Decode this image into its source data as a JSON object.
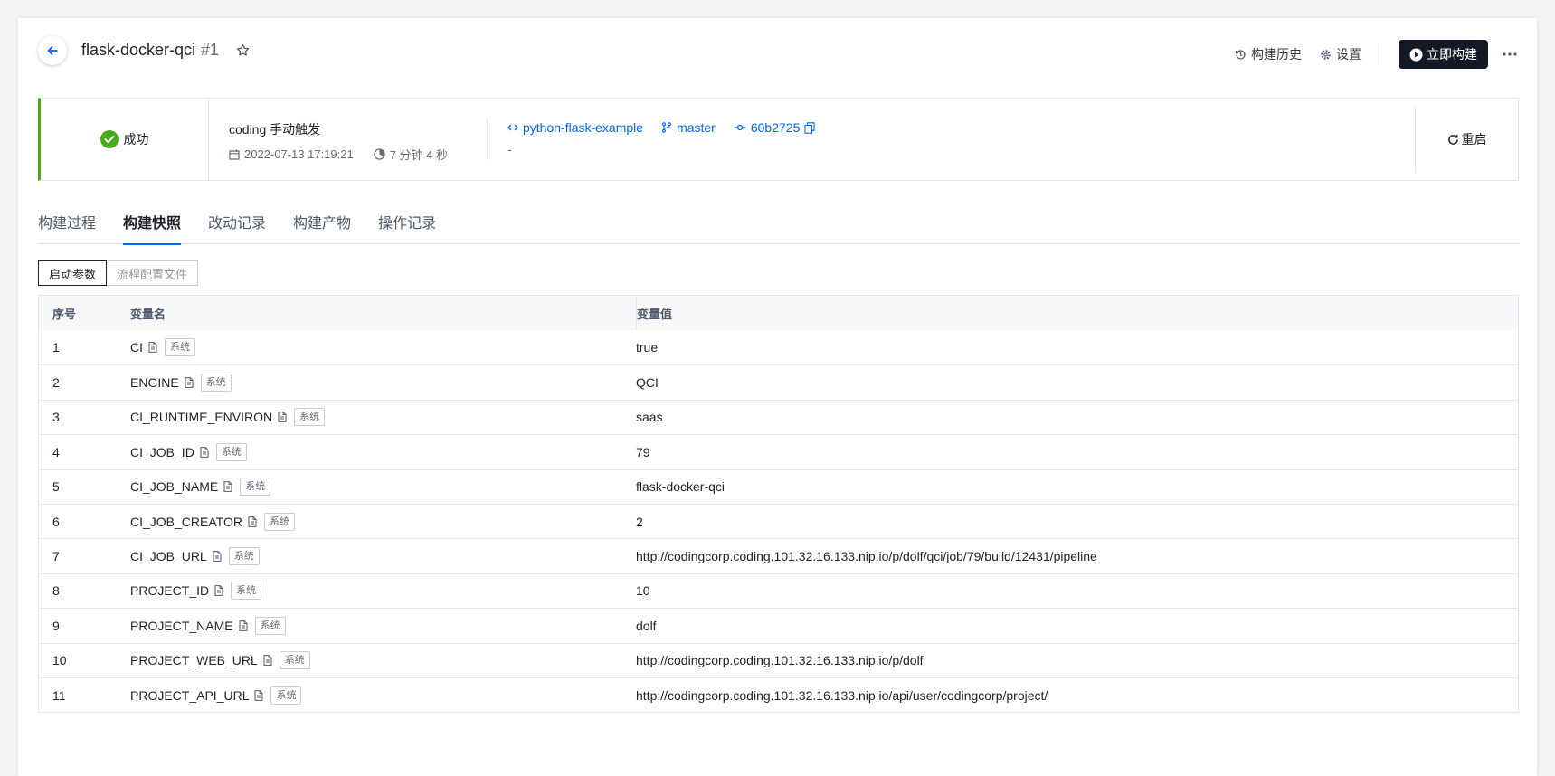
{
  "header": {
    "title": "flask-docker-qci",
    "build_number": "#1",
    "history_label": "构建历史",
    "settings_label": "设置",
    "build_now_label": "立即构建"
  },
  "status": {
    "result": "成功",
    "trigger": "coding 手动触发",
    "date": "2022-07-13 17:19:21",
    "duration": "7 分钟 4 秒",
    "repo": "python-flask-example",
    "branch": "master",
    "commit": "60b2725",
    "description": "-",
    "restart_label": "重启",
    "accent_color": "#49aa19"
  },
  "tabs": [
    {
      "label": "构建过程",
      "active": false
    },
    {
      "label": "构建快照",
      "active": true
    },
    {
      "label": "改动记录",
      "active": false
    },
    {
      "label": "构建产物",
      "active": false
    },
    {
      "label": "操作记录",
      "active": false
    }
  ],
  "segments": [
    {
      "label": "启动参数",
      "active": true
    },
    {
      "label": "流程配置文件",
      "active": false
    }
  ],
  "table": {
    "headers": {
      "index": "序号",
      "name": "变量名",
      "value": "变量值"
    },
    "badge": "系统",
    "rows": [
      {
        "index": "1",
        "name": "CI",
        "value": "true"
      },
      {
        "index": "2",
        "name": "ENGINE",
        "value": "QCI"
      },
      {
        "index": "3",
        "name": "CI_RUNTIME_ENVIRON",
        "value": "saas"
      },
      {
        "index": "4",
        "name": "CI_JOB_ID",
        "value": "79"
      },
      {
        "index": "5",
        "name": "CI_JOB_NAME",
        "value": "flask-docker-qci"
      },
      {
        "index": "6",
        "name": "CI_JOB_CREATOR",
        "value": "2"
      },
      {
        "index": "7",
        "name": "CI_JOB_URL",
        "value": "http://codingcorp.coding.101.32.16.133.nip.io/p/dolf/qci/job/79/build/12431/pipeline"
      },
      {
        "index": "8",
        "name": "PROJECT_ID",
        "value": "10"
      },
      {
        "index": "9",
        "name": "PROJECT_NAME",
        "value": "dolf"
      },
      {
        "index": "10",
        "name": "PROJECT_WEB_URL",
        "value": "http://codingcorp.coding.101.32.16.133.nip.io/p/dolf"
      },
      {
        "index": "11",
        "name": "PROJECT_API_URL",
        "value": "http://codingcorp.coding.101.32.16.133.nip.io/api/user/codingcorp/project/"
      }
    ]
  }
}
